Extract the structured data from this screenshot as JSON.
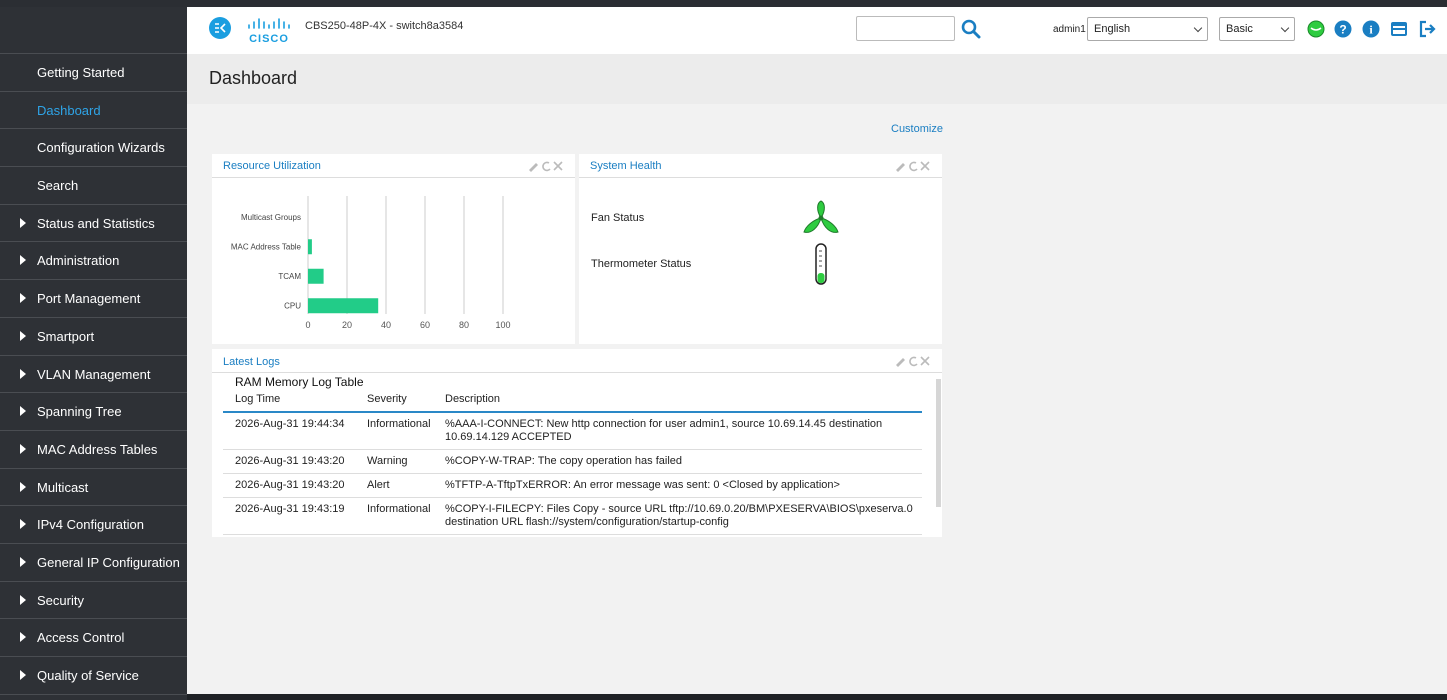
{
  "app": {
    "device_name": "CBS250-48P-4X - switch8a3584",
    "user": "admin1",
    "language": "English",
    "mode": "Basic",
    "search_placeholder": "",
    "accent": "#1a9ee0"
  },
  "sidebar": {
    "items": [
      {
        "label": "Getting Started",
        "expandable": false
      },
      {
        "label": "Dashboard",
        "expandable": false,
        "active": true
      },
      {
        "label": "Configuration Wizards",
        "expandable": false
      },
      {
        "label": "Search",
        "expandable": false
      },
      {
        "label": "Status and Statistics",
        "expandable": true
      },
      {
        "label": "Administration",
        "expandable": true
      },
      {
        "label": "Port Management",
        "expandable": true
      },
      {
        "label": "Smartport",
        "expandable": true
      },
      {
        "label": "VLAN Management",
        "expandable": true
      },
      {
        "label": "Spanning Tree",
        "expandable": true
      },
      {
        "label": "MAC Address Tables",
        "expandable": true
      },
      {
        "label": "Multicast",
        "expandable": true
      },
      {
        "label": "IPv4 Configuration",
        "expandable": true
      },
      {
        "label": "General IP Configuration",
        "expandable": true
      },
      {
        "label": "Security",
        "expandable": true
      },
      {
        "label": "Access Control",
        "expandable": true
      },
      {
        "label": "Quality of Service",
        "expandable": true
      }
    ]
  },
  "main": {
    "title": "Dashboard",
    "customize_label": "Customize"
  },
  "resource_panel": {
    "title": "Resource Utilization",
    "bar_color": "#22cc88"
  },
  "health_panel": {
    "title": "System Health",
    "fan_label": "Fan Status",
    "thermo_label": "Thermometer Status",
    "ok_color": "#2ecc40"
  },
  "logs_panel": {
    "title": "Latest Logs",
    "table_title": "RAM Memory Log Table",
    "columns": [
      "Log Time",
      "Severity",
      "Description"
    ],
    "rows": [
      {
        "time": "2026-Aug-31 19:44:34",
        "severity": "Informational",
        "desc1": "%AAA-I-CONNECT: New http connection for user admin1, source 10.69.14.45 destination",
        "desc2": "10.69.14.129 ACCEPTED"
      },
      {
        "time": "2026-Aug-31 19:43:20",
        "severity": "Warning",
        "desc1": "%COPY-W-TRAP: The copy operation has failed",
        "desc2": ""
      },
      {
        "time": "2026-Aug-31 19:43:20",
        "severity": "Alert",
        "desc1": "%TFTP-A-TftpTxERROR: An error message was sent: 0 <Closed by application>",
        "desc2": ""
      },
      {
        "time": "2026-Aug-31 19:43:19",
        "severity": "Informational",
        "desc1": "%COPY-I-FILECPY: Files Copy - source URL tftp://10.69.0.20/BM\\PXESERVA\\BIOS\\pxeserva.0",
        "desc2": "destination URL flash://system/configuration/startup-config"
      }
    ]
  },
  "chart_data": {
    "type": "bar",
    "orientation": "horizontal",
    "categories": [
      "Multicast Groups",
      "MAC Address Table",
      "TCAM",
      "CPU"
    ],
    "values": [
      0,
      2,
      8,
      36
    ],
    "xlim": [
      0,
      100
    ],
    "xticks": [
      "0",
      "20",
      "40",
      "60",
      "80",
      "100"
    ],
    "grid": true,
    "title": "",
    "xlabel": "",
    "ylabel": ""
  }
}
